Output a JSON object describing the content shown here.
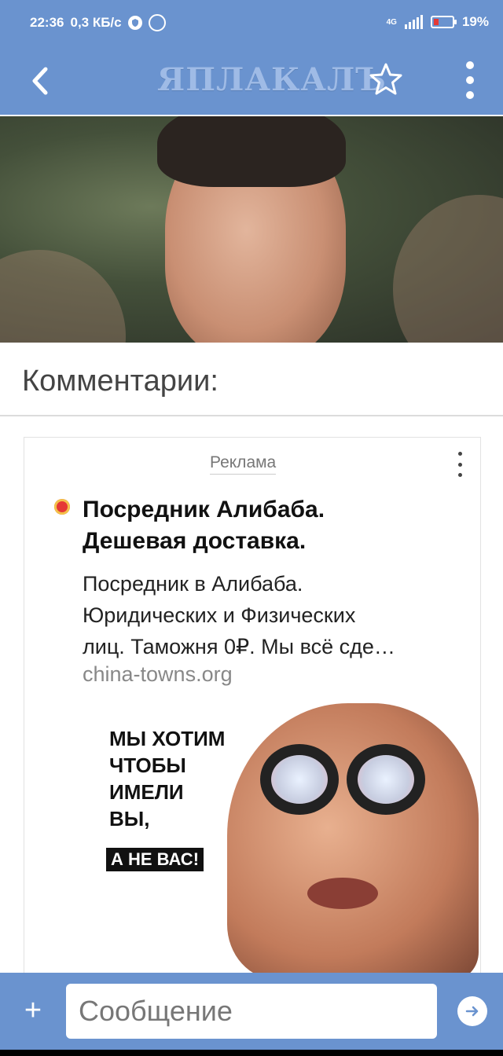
{
  "status": {
    "time": "22:36",
    "speed": "0,3 КБ/с",
    "network": "4G",
    "battery": "19%"
  },
  "app": {
    "logo_text": "ЯПЛАКАЛЪ",
    "icons": [
      "back-arrow-icon",
      "star-icon",
      "more-vert-icon"
    ]
  },
  "comments": {
    "title": "Комментарии:"
  },
  "ad": {
    "label": "Реклама",
    "title_line1": "Посредник Алибаба.",
    "title_line2": "Дешевая доставка.",
    "text_line1": "Посредник в Алибаба.",
    "text_line2": "Юридических и Физических",
    "text_line3": "лиц. Таможня 0₽. Мы всё сде…",
    "domain": "china-towns.org",
    "image_text_lines": [
      "МЫ ХОТИМ",
      "ЧТОБЫ",
      "ИМЕЛИ",
      "ВЫ,"
    ],
    "image_tag": "А НЕ ВАС!"
  },
  "composer": {
    "placeholder": "Сообщение"
  },
  "colors": {
    "bar": "#6a93cf",
    "logo": "#9fbbe6",
    "battery_low": "#e53935"
  }
}
